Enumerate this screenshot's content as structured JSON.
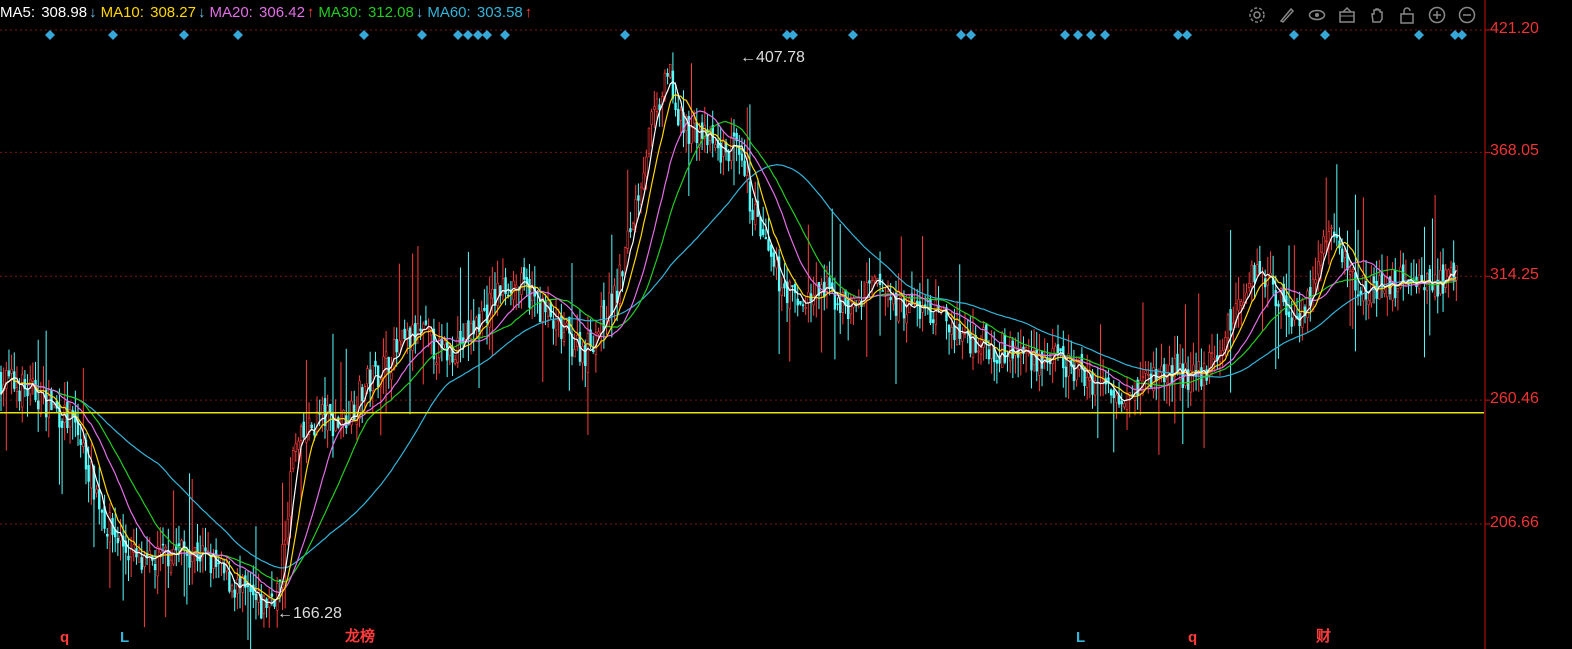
{
  "ma_legend": [
    {
      "label": "MA5: ",
      "value": "308.98",
      "arrow": "↓",
      "color": "#ffffff",
      "arrow_color": "#6ab7e8"
    },
    {
      "label": "MA10: ",
      "value": "308.27",
      "arrow": "↓",
      "color": "#ffd700",
      "arrow_color": "#6ab7e8"
    },
    {
      "label": "MA20: ",
      "value": "306.42",
      "arrow": "↑",
      "color": "#e36ee6",
      "arrow_color": "#ff3b3b"
    },
    {
      "label": "MA30: ",
      "value": "312.08",
      "arrow": "↓",
      "color": "#22cc22",
      "arrow_color": "#6ab7e8"
    },
    {
      "label": "MA60: ",
      "value": "303.58",
      "arrow": "↑",
      "color": "#34b4d9",
      "arrow_color": "#ff3b3b"
    }
  ],
  "toolbar": [
    "gear-icon",
    "pen-icon",
    "eye-icon",
    "basket-icon",
    "hand-icon",
    "lock-icon",
    "zoom-in-icon",
    "zoom-out-icon"
  ],
  "chart_data": {
    "type": "candlestick",
    "y_ticks": [
      "421.20",
      "368.05",
      "314.25",
      "260.46",
      "206.66"
    ],
    "ylim": [
      152,
      440
    ],
    "reference_line": 255,
    "extremes": {
      "high": "407.78",
      "low": "166.28"
    },
    "colors": {
      "up": "#ff3b3b",
      "down": "#54ffff",
      "ma5": "#ffffff",
      "ma10": "#ffd700",
      "ma20": "#e36ee6",
      "ma30": "#22cc22",
      "ma60": "#34b4d9",
      "ref": "#e6e600",
      "grid": "#7a1818",
      "axis": "#cc1111"
    },
    "price_path": [
      [
        0,
        270
      ],
      [
        15,
        262
      ],
      [
        28,
        249
      ],
      [
        40,
        206
      ],
      [
        54,
        187
      ],
      [
        65,
        196
      ],
      [
        75,
        194
      ],
      [
        90,
        178
      ],
      [
        98,
        170
      ],
      [
        105,
        180
      ],
      [
        110,
        237
      ],
      [
        120,
        254
      ],
      [
        128,
        250
      ],
      [
        138,
        268
      ],
      [
        150,
        283
      ],
      [
        158,
        290
      ],
      [
        166,
        280
      ],
      [
        177,
        290
      ],
      [
        187,
        307
      ],
      [
        192,
        312
      ],
      [
        200,
        306
      ],
      [
        210,
        290
      ],
      [
        220,
        282
      ],
      [
        232,
        307
      ],
      [
        240,
        352
      ],
      [
        245,
        380
      ],
      [
        252,
        402
      ],
      [
        255,
        380
      ],
      [
        262,
        378
      ],
      [
        270,
        368
      ],
      [
        276,
        370
      ],
      [
        282,
        348
      ],
      [
        290,
        318
      ],
      [
        300,
        302
      ],
      [
        310,
        308
      ],
      [
        320,
        300
      ],
      [
        330,
        310
      ],
      [
        338,
        302
      ],
      [
        350,
        299
      ],
      [
        362,
        289
      ],
      [
        375,
        283
      ],
      [
        388,
        280
      ],
      [
        400,
        276
      ],
      [
        410,
        270
      ],
      [
        420,
        264
      ],
      [
        432,
        270
      ],
      [
        440,
        273
      ],
      [
        450,
        270
      ],
      [
        458,
        279
      ],
      [
        465,
        300
      ],
      [
        473,
        320
      ],
      [
        480,
        308
      ],
      [
        486,
        297
      ],
      [
        492,
        302
      ],
      [
        500,
        335
      ],
      [
        510,
        312
      ],
      [
        520,
        308
      ],
      [
        530,
        315
      ],
      [
        540,
        311
      ],
      [
        548,
        312
      ]
    ],
    "markers_bottom": [
      "q",
      "L",
      "龙榜",
      "L",
      "q",
      "财"
    ],
    "diamonds_count": 30
  }
}
